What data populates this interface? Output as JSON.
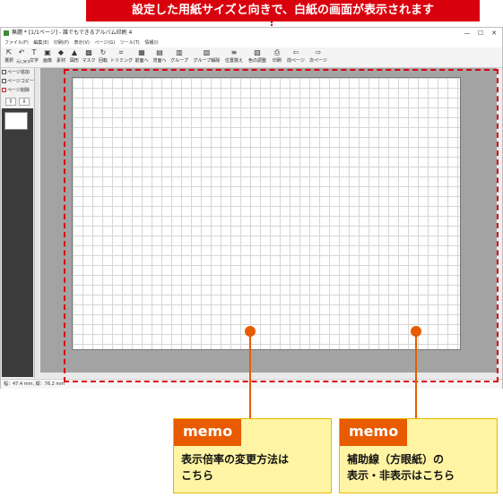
{
  "banner": {
    "text": "設定した用紙サイズと向きで、白紙の画面が表示されます"
  },
  "app": {
    "title": "無題 * [1/1ページ] - 誰でもできるアルバム印刷 4",
    "window_controls": [
      "—",
      "☐",
      "✕"
    ],
    "menu": [
      "ファイル(F)",
      "編集(E)",
      "印刷(P)",
      "表示(V)",
      "ページ(G)",
      "ツール(T)",
      "情報(I)"
    ],
    "toolbar": [
      {
        "label": "選択",
        "icon": "pointer-icon",
        "glyph": "⇱"
      },
      {
        "label": "元に戻す",
        "icon": "undo-icon",
        "glyph": "↶"
      },
      {
        "label": "文字",
        "icon": "text-icon",
        "glyph": "T"
      },
      {
        "label": "画像",
        "icon": "image-icon",
        "glyph": "▣"
      },
      {
        "label": "素材",
        "icon": "material-icon",
        "glyph": "◆"
      },
      {
        "label": "図形",
        "icon": "shape-icon",
        "glyph": "▲"
      },
      {
        "label": "マスク",
        "icon": "mask-icon",
        "glyph": "▩"
      },
      {
        "label": "回転",
        "icon": "rotate-icon",
        "glyph": "↻"
      },
      {
        "label": "トリミング",
        "icon": "trim-icon",
        "glyph": "⌗"
      },
      {
        "label": "前面へ",
        "icon": "front-icon",
        "glyph": "▦"
      },
      {
        "label": "背面へ",
        "icon": "back-icon",
        "glyph": "▤"
      },
      {
        "label": "グループ",
        "icon": "group-icon",
        "glyph": "▥"
      },
      {
        "label": "グループ解除",
        "icon": "ungroup-icon",
        "glyph": "▧"
      },
      {
        "label": "位置揃え",
        "icon": "align-icon",
        "glyph": "≡"
      },
      {
        "label": "色の調整",
        "icon": "color-adjust-icon",
        "glyph": "▨"
      },
      {
        "label": "印刷",
        "icon": "print-icon",
        "glyph": "⎙"
      },
      {
        "label": "前ページ",
        "icon": "prev-page-icon",
        "glyph": "⇦"
      },
      {
        "label": "次ページ",
        "icon": "next-page-icon",
        "glyph": "⇨"
      }
    ],
    "left_panel": {
      "add": "ページ追加",
      "copy": "ページコピー",
      "delete": "ページ削除",
      "up": "⇧",
      "down": "⇩"
    },
    "status": "幅：47.4 mm, 縦：76.2 mm",
    "colors": {
      "accent_red": "#d9000d",
      "memo_orange": "#e85b00",
      "memo_bg": "#fff4a3"
    }
  },
  "memos": [
    {
      "tag": "memo",
      "text": "表示倍率の変更方法は\nこちら"
    },
    {
      "tag": "memo",
      "text": "補助線（方眼紙）の\n表示・非表示はこちら"
    }
  ]
}
